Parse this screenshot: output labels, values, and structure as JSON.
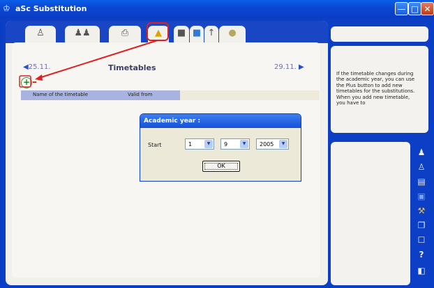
{
  "window": {
    "title": "aSc Substitution",
    "app_icon": "asc-logo-icon",
    "buttons": {
      "minimize": "minimize-icon",
      "maximize": "maximize-icon",
      "close": "close-icon"
    }
  },
  "tabs": [
    {
      "icon": "teacher-icon"
    },
    {
      "icon": "group-icon"
    },
    {
      "icon": "printer-icon"
    },
    {
      "icon": "timetable-settings-icon",
      "highlighted": true
    },
    {
      "icon": "school-icon"
    },
    {
      "icon": "book-icon"
    },
    {
      "icon": "upload-icon"
    },
    {
      "icon": "cd-icon"
    }
  ],
  "main": {
    "prev_label": "25.11.",
    "title": "Timetables",
    "next_label": "29.11.",
    "plus_label": "+",
    "minus_label": "–",
    "columns": [
      "Name of the timetable",
      "Valid from"
    ]
  },
  "dialog": {
    "title": "Academic year :",
    "start_label": "Start",
    "day": "1",
    "month": "9",
    "year": "2005",
    "ok_label": "OK"
  },
  "help": {
    "text": "If the timetable changes during the academic year, you can use the Plus button to add new timetables for the substitutions. When you add new timetable, you have to"
  },
  "sidebar_icons": [
    "people-icon",
    "teachers-icon",
    "classroom-icon",
    "save-icon",
    "tools-icon",
    "window-icon",
    "blank-window-icon",
    "help-icon",
    "exit-icon"
  ],
  "colors": {
    "window_blue": "#0a3fc5",
    "highlight_red": "#e02020",
    "grid_blue": "#a9b3e0"
  }
}
